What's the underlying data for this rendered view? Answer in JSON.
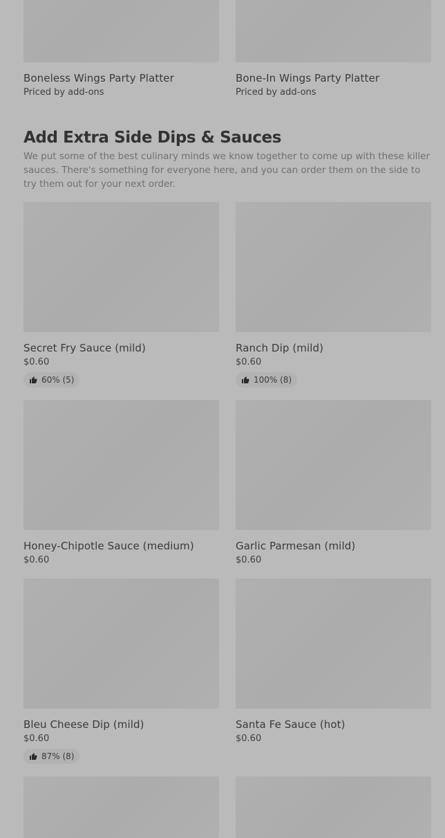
{
  "top_items": [
    {
      "name": "Boneless Wings Party Platter",
      "price": "Priced by add-ons"
    },
    {
      "name": "Bone-In Wings Party Platter",
      "price": "Priced by add-ons"
    }
  ],
  "section": {
    "title": "Add Extra Side Dips & Sauces",
    "description": "We put some of the best culinary minds we know together to come up with these killer sauces. There's something for everyone here, and you can order them on the side to try them out for your next order."
  },
  "items": [
    {
      "name": "Secret Fry Sauce (mild)",
      "price": "$0.60",
      "rating": "60% (5)"
    },
    {
      "name": "Ranch Dip (mild)",
      "price": "$0.60",
      "rating": "100% (8)"
    },
    {
      "name": "Honey-Chipotle Sauce (medium)",
      "price": "$0.60"
    },
    {
      "name": "Garlic Parmesan (mild)",
      "price": "$0.60"
    },
    {
      "name": "Bleu Cheese Dip (mild)",
      "price": "$0.60",
      "rating": "87% (8)"
    },
    {
      "name": "Santa Fe Sauce (hot)",
      "price": "$0.60"
    }
  ],
  "icons": {
    "rating": "thumbs-up-icon"
  },
  "colors": {
    "overlay_background": "#bababa",
    "image_placeholder": "#b0b0b0",
    "text_primary": "#3a3a3a",
    "text_secondary": "#707070"
  }
}
